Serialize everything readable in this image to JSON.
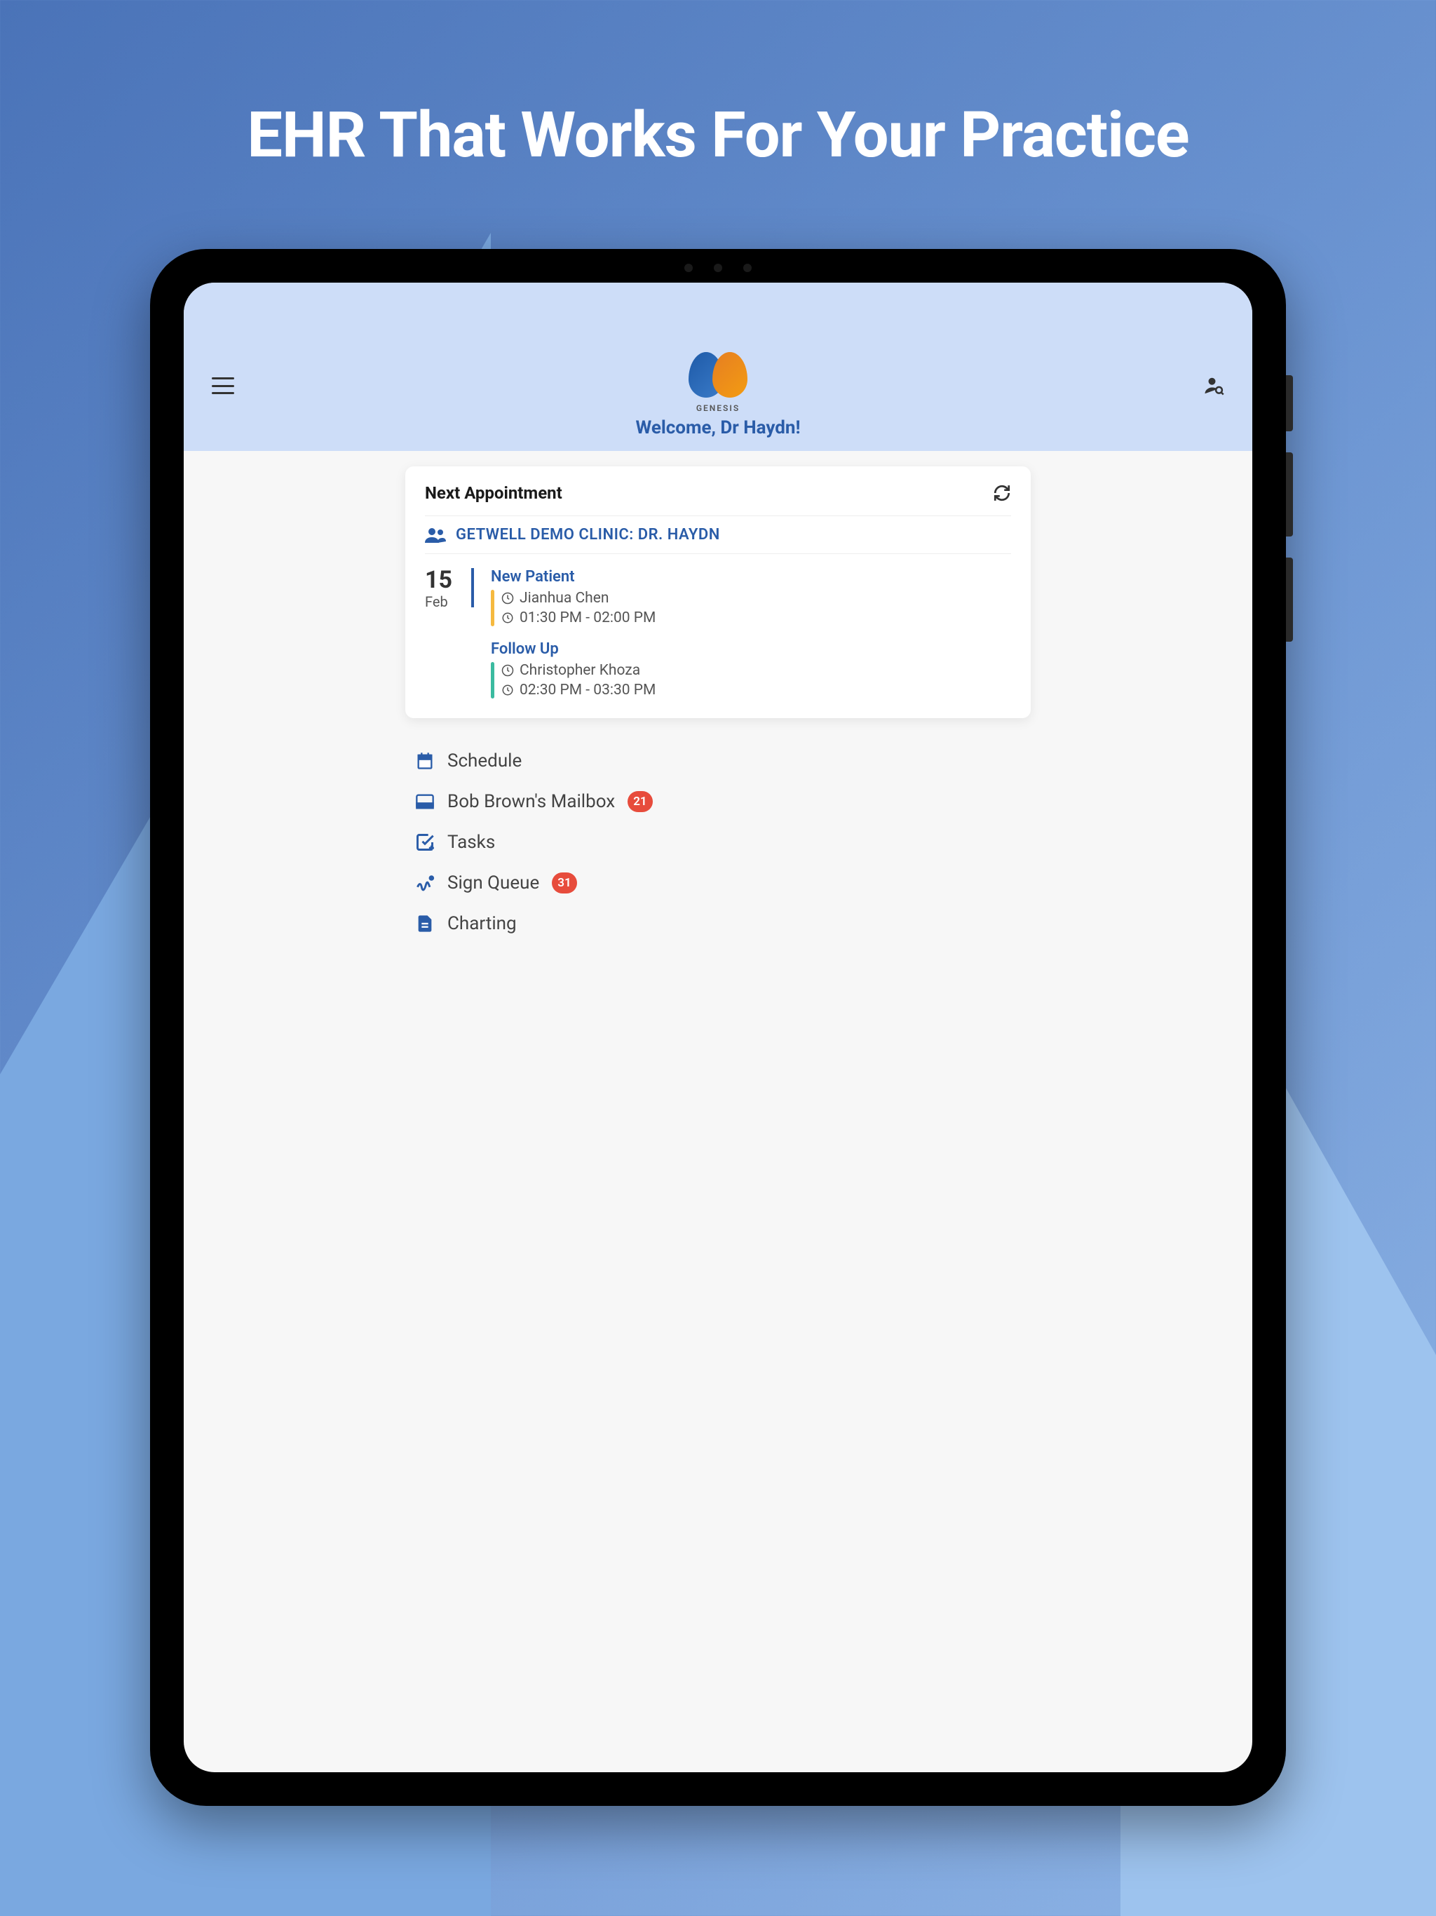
{
  "hero": {
    "title": "EHR That Works For Your Practice"
  },
  "header": {
    "logo_text": "GENESIS",
    "welcome": "Welcome, Dr Haydn!"
  },
  "card": {
    "title": "Next Appointment",
    "clinic": "GETWELL DEMO CLINIC: DR. HAYDN",
    "date": {
      "day": "15",
      "month": "Feb"
    },
    "appointments": [
      {
        "type": "New Patient",
        "patient": "Jianhua Chen",
        "time": "01:30 PM - 02:00 PM",
        "bar_color": "bar-yellow"
      },
      {
        "type": "Follow Up",
        "patient": "Christopher Khoza",
        "time": "02:30 PM - 03:30 PM",
        "bar_color": "bar-teal"
      }
    ]
  },
  "nav": {
    "items": [
      {
        "icon": "calendar",
        "label": "Schedule",
        "badge": null
      },
      {
        "icon": "mailbox",
        "label": "Bob Brown's Mailbox",
        "badge": "21"
      },
      {
        "icon": "tasks",
        "label": "Tasks",
        "badge": null
      },
      {
        "icon": "sign",
        "label": "Sign Queue",
        "badge": "31"
      },
      {
        "icon": "chart",
        "label": "Charting",
        "badge": null
      }
    ]
  },
  "colors": {
    "primary": "#2a5ca8",
    "badge": "#e74c3c"
  }
}
